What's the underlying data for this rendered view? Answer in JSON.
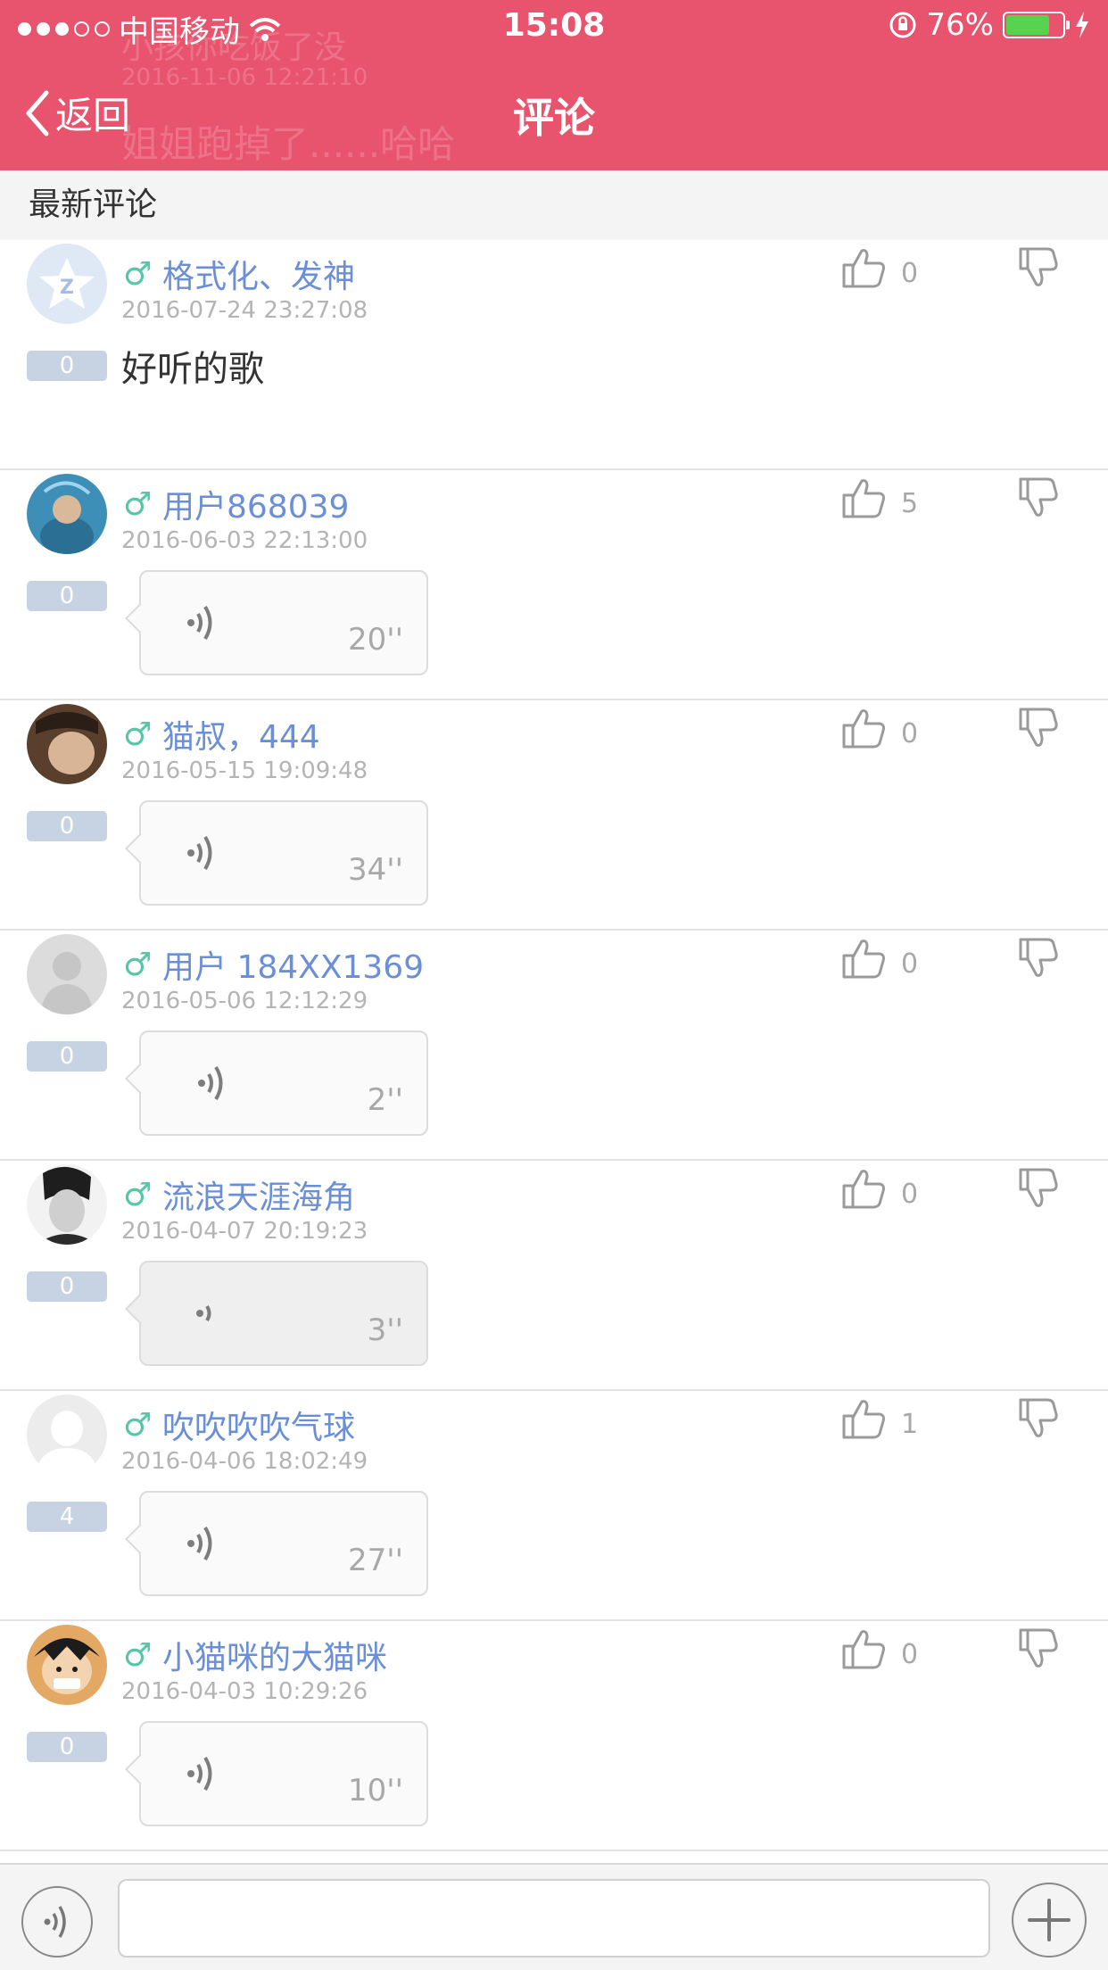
{
  "status_bar": {
    "carrier": "中国移动",
    "time": "15:08",
    "battery": "76%"
  },
  "nav": {
    "back_label": "返回",
    "title": "评论"
  },
  "ghost": {
    "line1": "小孩你吃饭了没",
    "line2": "2016-11-06 12:21:10",
    "line3": "姐姐跑掉了......哈哈"
  },
  "section_title": "最新评论",
  "comments": [
    {
      "gender": "♂",
      "name": "格式化、发神",
      "date": "2016-07-24 23:27:08",
      "floor": "0",
      "text": "好听的歌",
      "likes": "0",
      "avatar_color": "#dfe8f5"
    },
    {
      "gender": "♂",
      "name": "用户868039",
      "date": "2016-06-03 22:13:00",
      "floor": "0",
      "duration": "20''",
      "likes": "5",
      "avatar_color": "#3e8fb8"
    },
    {
      "gender": "♂",
      "name": "猫叔，444",
      "date": "2016-05-15 19:09:48",
      "floor": "0",
      "duration": "34''",
      "likes": "0",
      "avatar_color": "#5a3f2c"
    },
    {
      "gender": "♂",
      "name": "用户 184XX1369",
      "date": "2016-05-06 12:12:29",
      "floor": "0",
      "duration": "2''",
      "likes": "0",
      "avatar_color": "#dcdcdc"
    },
    {
      "gender": "♂",
      "name": "流浪天涯海角",
      "date": "2016-04-07 20:19:23",
      "floor": "0",
      "duration": "3''",
      "likes": "0",
      "avatar_color": "#2b2b2b"
    },
    {
      "gender": "♂",
      "name": "吹吹吹吹气球",
      "date": "2016-04-06 18:02:49",
      "floor": "4",
      "duration": "27''",
      "likes": "1",
      "avatar_color": "#ececec"
    },
    {
      "gender": "♂",
      "name": "小猫咪的大猫咪",
      "date": "2016-04-03 10:29:26",
      "floor": "0",
      "duration": "10''",
      "likes": "0",
      "avatar_color": "#e3a864"
    }
  ],
  "input": {
    "placeholder": ""
  },
  "colors": {
    "accent": "#e8536e",
    "name": "#6b8fd6",
    "gender": "#57c6a7",
    "badge": "#c7d3e3"
  }
}
